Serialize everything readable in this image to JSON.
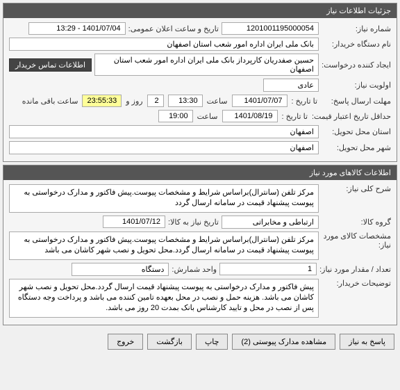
{
  "panel1": {
    "title": "جزئیات اطلاعات نیاز",
    "rows": {
      "req_no": {
        "label": "شماره نیاز:",
        "value": "1201001195000054"
      },
      "announce": {
        "label": "تاریخ و ساعت اعلان عمومی:",
        "value": "1401/07/04 - 13:29"
      },
      "buyer": {
        "label": "نام دستگاه خریدار:",
        "value": "بانک ملی ایران اداره امور شعب استان اصفهان"
      },
      "creator": {
        "label": "ایجاد کننده درخواست:",
        "value": "حسین صفدریان کارپرداز بانک ملی ایران اداره امور شعب استان اصفهان"
      },
      "contact_btn": "اطلاعات تماس خریدار",
      "priority": {
        "label": "اولویت نیاز:",
        "value": "عادی"
      },
      "deadline": {
        "label": "مهلت ارسال پاسخ:",
        "to_label": "تا تاریخ :",
        "date": "1401/07/07",
        "time_label": "ساعت",
        "time": "13:30",
        "days": "2",
        "days_label": "روز و",
        "countdown": "23:55:33",
        "remain_label": "ساعت باقی مانده"
      },
      "min_validity": {
        "label": "حداقل تاریخ اعتبار قیمت:",
        "to_label": "تا تاریخ :",
        "date": "1401/08/19",
        "time_label": "ساعت",
        "time": "19:00"
      },
      "delivery_prov": {
        "label": "استان محل تحویل:",
        "value": "اصفهان"
      },
      "delivery_city": {
        "label": "شهر محل تحویل:",
        "value": "اصفهان"
      }
    }
  },
  "panel2": {
    "title": "اطلاعات کالاهای مورد نیاز",
    "desc": {
      "label": "شرح کلی نیاز:",
      "value": "مرکز تلفن (سانترال)براساس شرایط و مشخصات پیوست.پیش فاکتور و مدارک درخواستی به پیوست پیشنهاد قیمت در سامانه ارسال گردد"
    },
    "group": {
      "label": "گروه کالا:",
      "value": "ارتباطی و مخابراتی",
      "date_label": "تاریخ نیاز به کالا:",
      "date": "1401/07/12"
    },
    "spec": {
      "label": "مشخصات کالای مورد نیاز:",
      "value": "مرکز تلفن (سانترال)براساس شرایط و مشخصات پیوست.پیش فاکتور و مدارک درخواستی به پیوست پیشنهاد قیمت در سامانه ارسال گردد.محل تحویل و نصب شهر کاشان می باشد"
    },
    "qty": {
      "label": "تعداد / مقدار مورد نیاز:",
      "value": "1",
      "unit_label": "واحد شمارش:",
      "unit": "دستگاه"
    },
    "notes": {
      "label": "توضیحات خریدار:",
      "value": "پیش فاکتور و مدارک درخواستی به پیوست پیشنهاد قیمت ارسال گردد.محل تحویل و نصب شهر کاشان می باشد. هزینه حمل و نصب در محل بعهده تامین کننده می باشد و پرداخت وجه دستگاه پس از نصب در محل و تایید کارشناس بانک بمدت 20 روز می باشد."
    }
  },
  "footer": {
    "respond": "پاسخ به نیاز",
    "attachments2": "مشاهده مدارک پیوستی (2)",
    "print": "چاپ",
    "back": "بازگشت",
    "exit": "خروج"
  }
}
